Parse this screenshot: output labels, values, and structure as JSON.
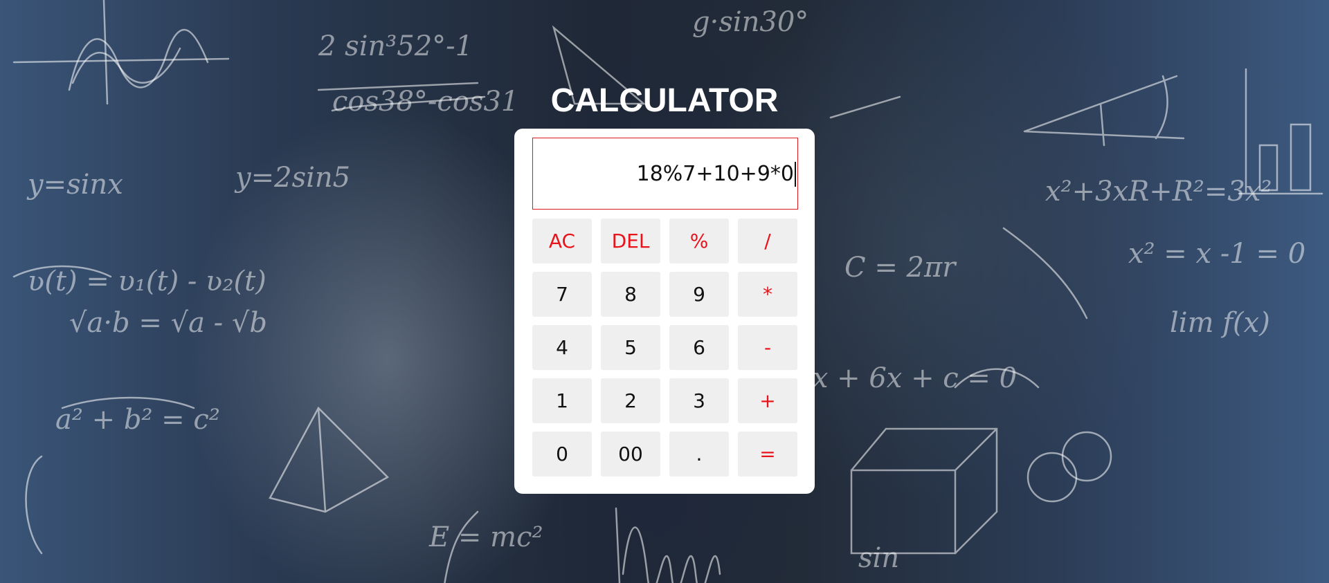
{
  "title": "CALCULATOR",
  "display": {
    "value": "18%7+10+9*0"
  },
  "keys": [
    {
      "label": "AC",
      "type": "op",
      "name": "all-clear-button"
    },
    {
      "label": "DEL",
      "type": "op",
      "name": "delete-button"
    },
    {
      "label": "%",
      "type": "op",
      "name": "modulo-button"
    },
    {
      "label": "/",
      "type": "op",
      "name": "divide-button"
    },
    {
      "label": "7",
      "type": "num",
      "name": "digit-7-button"
    },
    {
      "label": "8",
      "type": "num",
      "name": "digit-8-button"
    },
    {
      "label": "9",
      "type": "num",
      "name": "digit-9-button"
    },
    {
      "label": "*",
      "type": "op",
      "name": "multiply-button"
    },
    {
      "label": "4",
      "type": "num",
      "name": "digit-4-button"
    },
    {
      "label": "5",
      "type": "num",
      "name": "digit-5-button"
    },
    {
      "label": "6",
      "type": "num",
      "name": "digit-6-button"
    },
    {
      "label": "-",
      "type": "op",
      "name": "subtract-button"
    },
    {
      "label": "1",
      "type": "num",
      "name": "digit-1-button"
    },
    {
      "label": "2",
      "type": "num",
      "name": "digit-2-button"
    },
    {
      "label": "3",
      "type": "num",
      "name": "digit-3-button"
    },
    {
      "label": "+",
      "type": "op",
      "name": "add-button"
    },
    {
      "label": "0",
      "type": "num",
      "name": "digit-0-button"
    },
    {
      "label": "00",
      "type": "num",
      "name": "double-zero-button"
    },
    {
      "label": ".",
      "type": "num",
      "name": "decimal-point-button"
    },
    {
      "label": "=",
      "type": "op",
      "name": "equals-button"
    }
  ],
  "colors": {
    "operator": "#e8141c",
    "display_border": "#e0161f",
    "key_background": "#efefef"
  }
}
